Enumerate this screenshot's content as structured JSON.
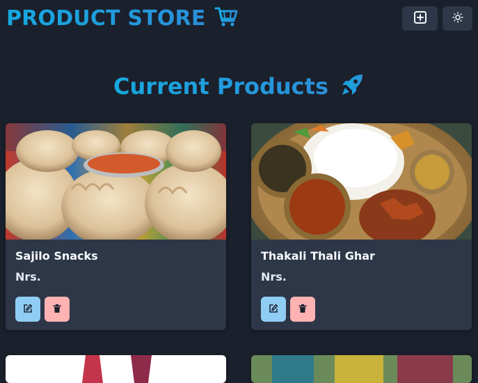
{
  "brand": {
    "title": "PRODUCT STORE",
    "icon": "shopping-cart-icon"
  },
  "nav": {
    "add_icon": "plus-square-icon",
    "theme_icon": "sun-icon"
  },
  "section": {
    "title": "Current Products",
    "icon": "rocket-icon"
  },
  "products": [
    {
      "name": "Sajilo Snacks",
      "price": "Nrs.",
      "image": "momo-dumplings-photo"
    },
    {
      "name": "Thakali Thali Ghar",
      "price": "Nrs.",
      "image": "thali-plate-photo"
    }
  ],
  "actions": {
    "edit_icon": "edit-icon",
    "delete_icon": "trash-icon"
  },
  "colors": {
    "accent": "#1aa6dc",
    "background": "#1a202c",
    "card": "#2d3748",
    "edit": "#90cdf4",
    "delete": "#feb2b2"
  }
}
